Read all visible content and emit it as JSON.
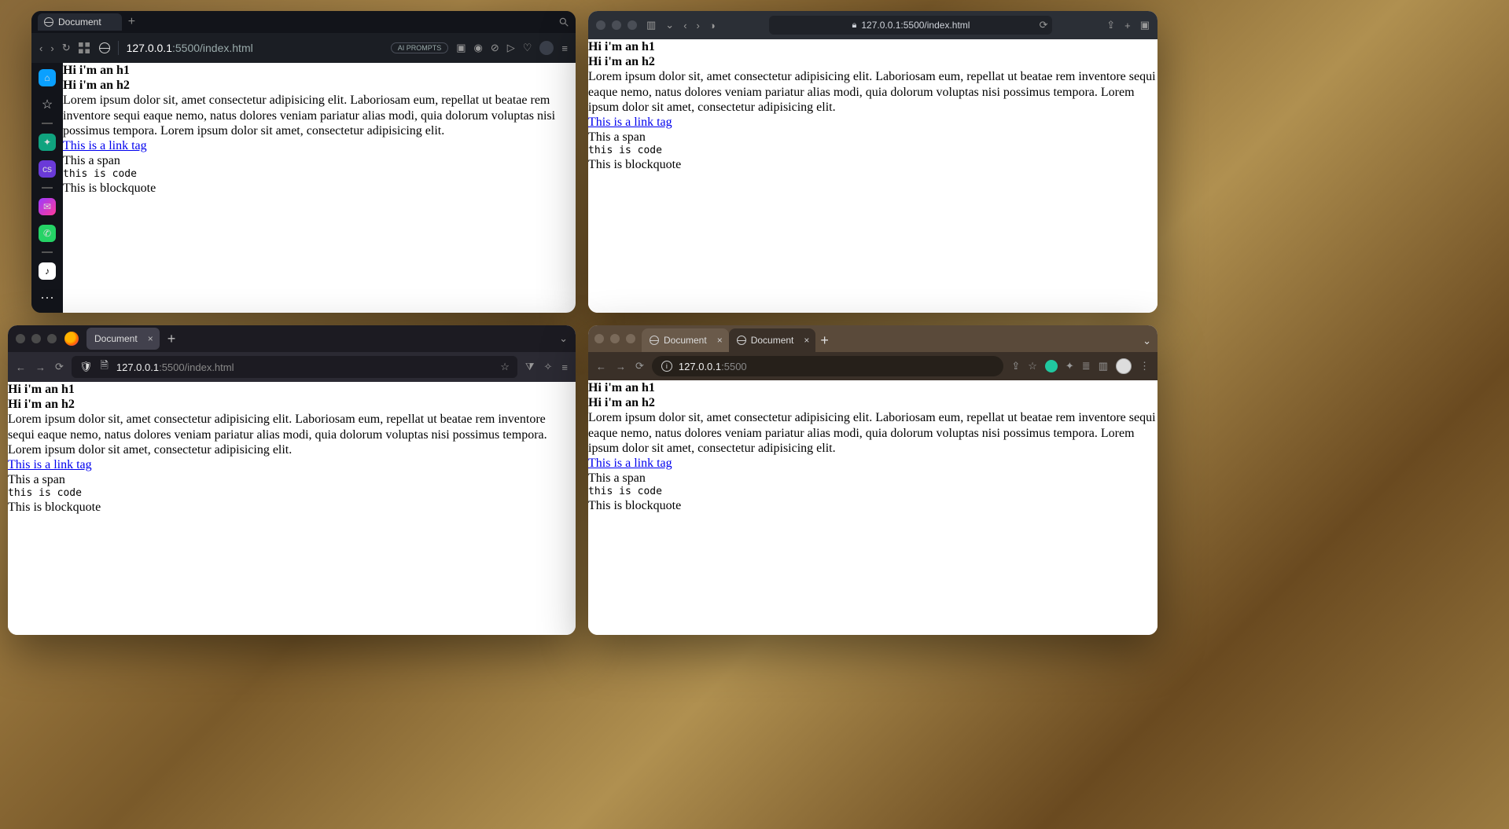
{
  "page": {
    "h1": "Hi i'm an h1",
    "h2": "Hi i'm an h2",
    "paragraph": "Lorem ipsum dolor sit, amet consectetur adipisicing elit. Laboriosam eum, repellat ut beatae rem inventore sequi eaque nemo, natus dolores veniam pariatur alias modi, quia dolorum voluptas nisi possimus tempora. Lorem ipsum dolor sit amet, consectetur adipisicing elit.",
    "link": "This is a link tag",
    "span": "This a span",
    "code": "this is code",
    "blockquote": "This is blockquote"
  },
  "opera": {
    "tab_title": "Document",
    "url_display": "127.0.0.1:5500/index.html",
    "ai_prompts": "AI PROMPTS",
    "sidebar_cs": "cs"
  },
  "safari": {
    "url_display": "127.0.0.1:5500/index.html"
  },
  "firefox": {
    "tab_title": "Document",
    "url_host": "127.0.0.1",
    "url_path": ":5500/index.html"
  },
  "chrome": {
    "tab1_title": "Document",
    "tab2_title": "Document",
    "url_host": "127.0.0.1",
    "url_path": ":5500"
  }
}
